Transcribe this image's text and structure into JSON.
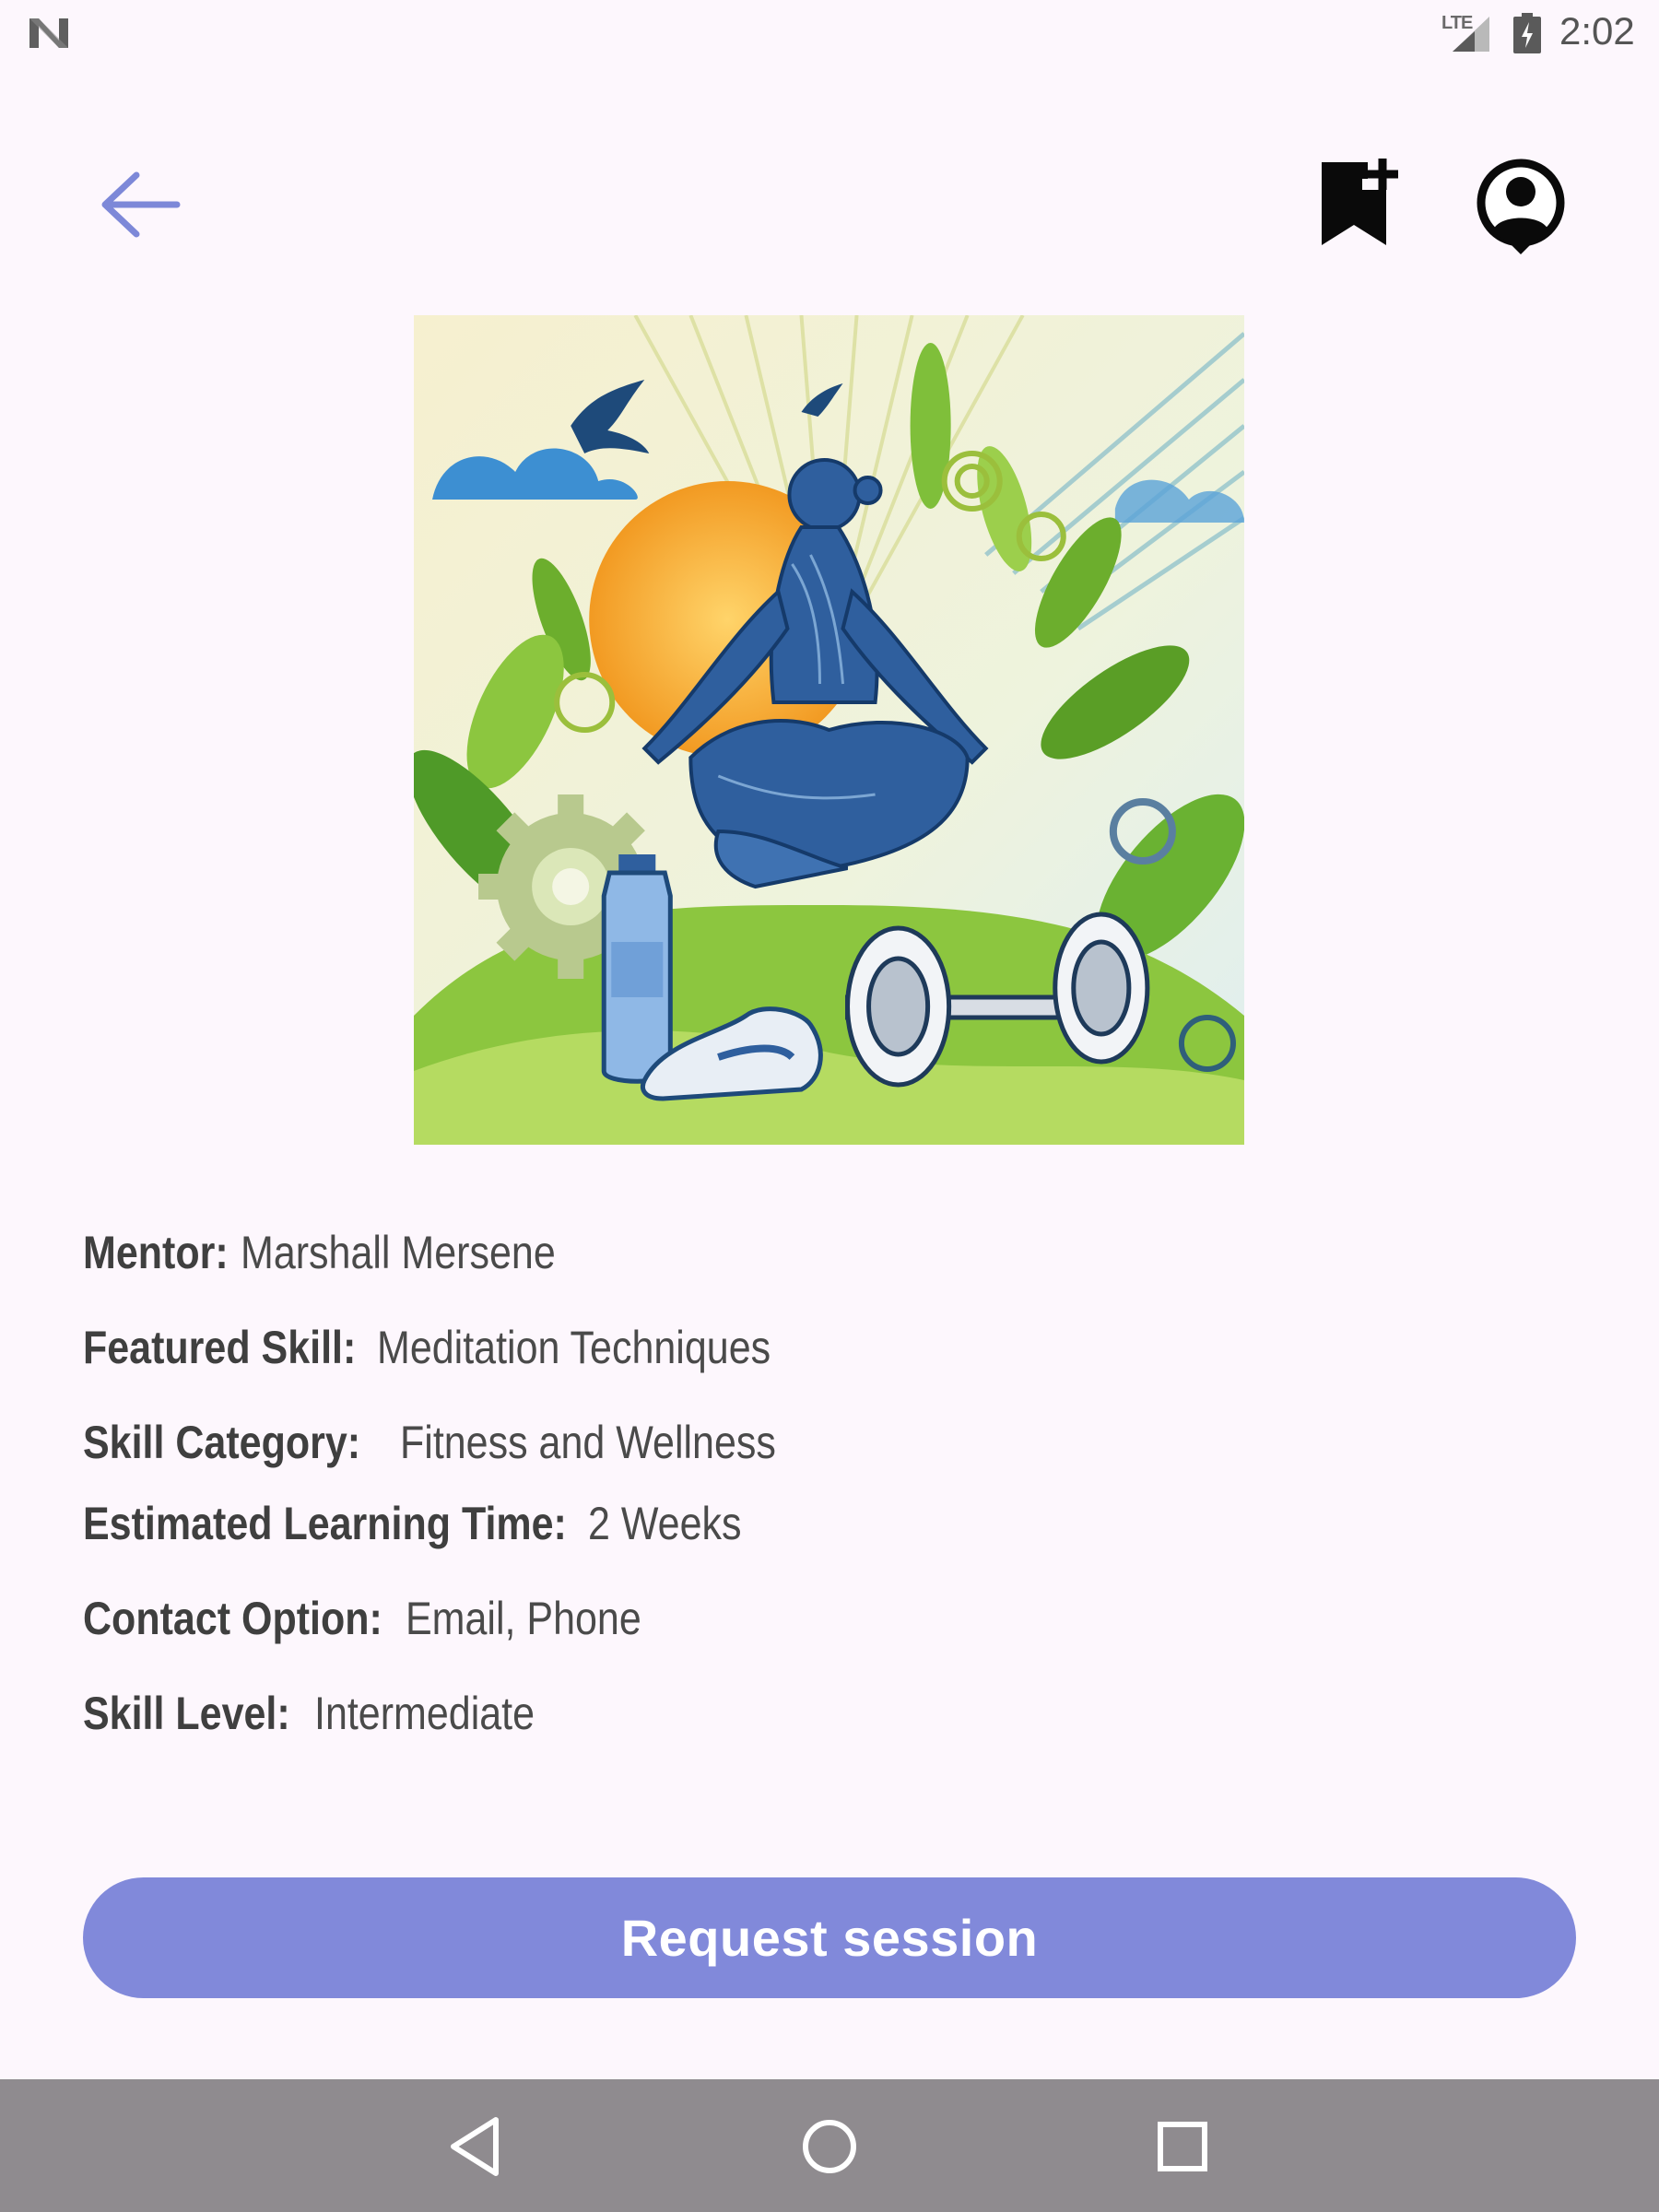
{
  "status_bar": {
    "network_label": "LTE",
    "time": "2:02",
    "icons": [
      "n-logo-icon",
      "signal-icon",
      "battery-charging-icon"
    ]
  },
  "app_bar": {
    "back_icon": "arrow-back-icon",
    "bookmark_icon": "bookmark-add-icon",
    "profile_icon": "account-circle-icon",
    "accent_color": "#7d88d8"
  },
  "hero_image": {
    "subject": "meditation-fitness-illustration"
  },
  "details": [
    {
      "label": "Mentor:",
      "value": "Marshall Mersene"
    },
    {
      "label": "Featured Skill:",
      "value": "Meditation Techniques"
    },
    {
      "label": "Skill Category:",
      "value": "Fitness and Wellness"
    },
    {
      "label": "Estimated Learning Time:",
      "value": "2 Weeks"
    },
    {
      "label": "Contact Option:",
      "value": "Email, Phone"
    },
    {
      "label": "Skill Level:",
      "value": "Intermediate"
    }
  ],
  "primary_action": {
    "label": "Request session",
    "color": "#8189da"
  },
  "nav_bar": {
    "icons": [
      "nav-back-icon",
      "nav-home-icon",
      "nav-recents-icon"
    ]
  }
}
